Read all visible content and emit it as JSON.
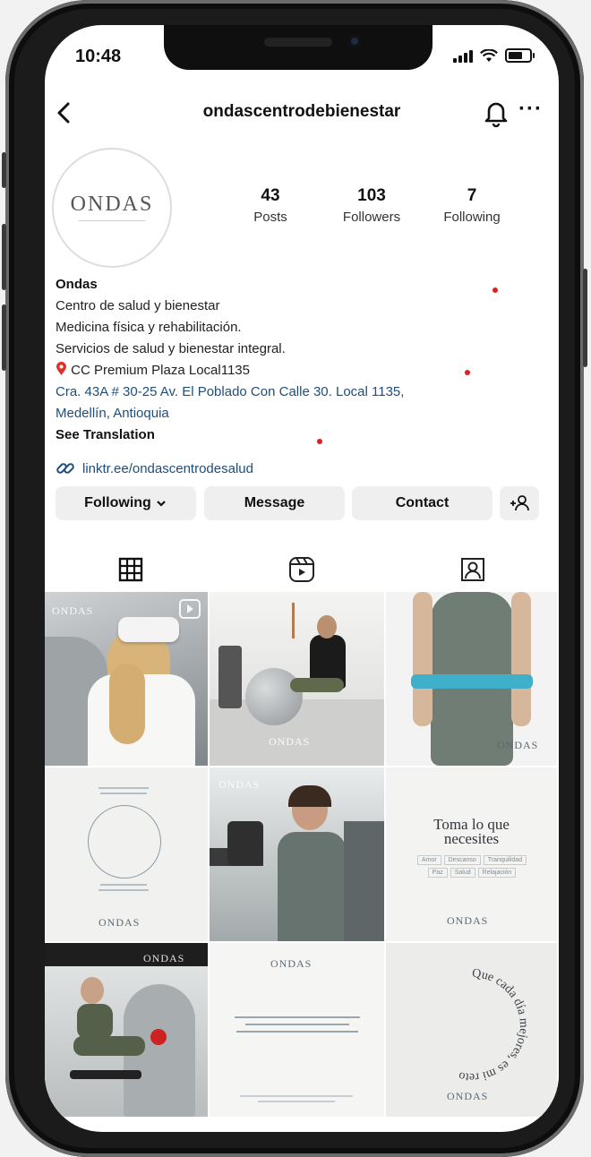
{
  "status_bar": {
    "time": "10:48",
    "signal_icon": "signal-bars-icon",
    "wifi_icon": "wifi-icon",
    "battery_icon": "battery-icon"
  },
  "header": {
    "username": "ondascentrodebienestar",
    "back_icon": "chevron-left-icon",
    "bell_icon": "bell-icon",
    "more_icon": "more-horizontal-icon",
    "more_label": "···"
  },
  "profile": {
    "avatar_text": "ONDAS",
    "stats": [
      {
        "value": "43",
        "label": "Posts"
      },
      {
        "value": "103",
        "label": "Followers"
      },
      {
        "value": "7",
        "label": "Following"
      }
    ],
    "name": "Ondas",
    "bio_lines": [
      "Centro de salud y bienestar",
      "Medicina física y rehabilitación.",
      "Servicios de salud y bienestar integral."
    ],
    "location": "CC Premium Plaza Local1135",
    "location_icon": "pin-icon",
    "address_lines": [
      "Cra. 43A # 30-25 Av. El Poblado Con Calle 30. Local 1135,",
      "Medellín, Antioquia"
    ],
    "translation": "See Translation",
    "link": "linktr.ee/ondascentrodesalud",
    "link_icon": "link-icon"
  },
  "actions": {
    "following": "Following",
    "following_chevron": "chevron-down-icon",
    "message": "Message",
    "contact": "Contact",
    "add_user_icon": "add-user-icon"
  },
  "tabs": [
    {
      "name": "grid",
      "icon": "grid-icon"
    },
    {
      "name": "reels",
      "icon": "reels-icon"
    },
    {
      "name": "tagged",
      "icon": "tagged-icon"
    }
  ],
  "posts": {
    "watermark": "ONDAS",
    "post_6_title_1": "Toma lo que",
    "post_6_title_2": "necesites",
    "post_6_tags": [
      "Amor",
      "Descanso",
      "Tranquilidad",
      "Paz",
      "Salud",
      "Relajación"
    ],
    "post_9_ring_text": "Que cada día mejores, es mi reto"
  }
}
